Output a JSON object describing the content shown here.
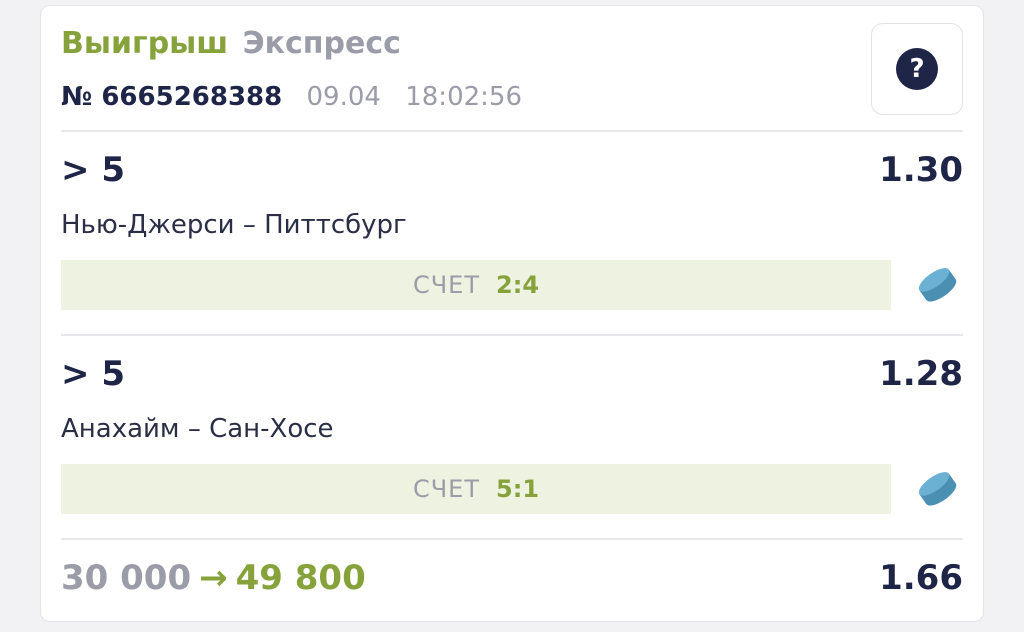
{
  "colors": {
    "accent_green": "#87a23b",
    "gray": "#9a9ca7",
    "dark": "#1f2547",
    "score_bg": "#eef2e1",
    "puck": "#5aa3c7"
  },
  "ticket": {
    "status": "Выигрыш",
    "type": "Экспресс",
    "number": "№ 6665268388",
    "date": "09.04",
    "time": "18:02:56",
    "help_icon": "question-mark-icon",
    "help_label": "?"
  },
  "events": [
    {
      "condition": "> 5",
      "odds": "1.30",
      "match": "Нью-Джерси – Питтсбург",
      "score_label": "СЧЕТ",
      "score": "2:4",
      "sport_icon": "hockey-puck-icon"
    },
    {
      "condition": "> 5",
      "odds": "1.28",
      "match": "Анахайм – Сан-Хосе",
      "score_label": "СЧЕТ",
      "score": "5:1",
      "sport_icon": "hockey-puck-icon"
    }
  ],
  "summary": {
    "stake": "30 000",
    "arrow": "→",
    "payout": "49 800",
    "total_odds": "1.66"
  }
}
